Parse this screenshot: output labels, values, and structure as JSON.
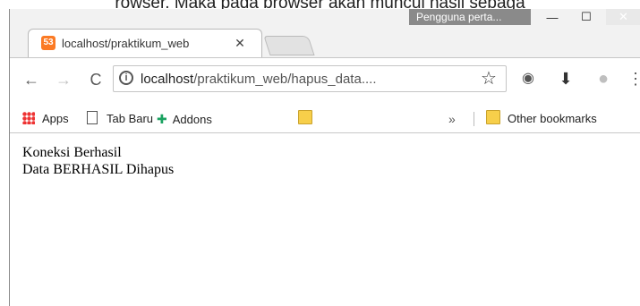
{
  "caption_cut": "rowser. Maka pada browser akan muncul hasil sebaga",
  "window": {
    "profile_label": "Pengguna perta...",
    "min_glyph": "—",
    "max_glyph": "☐",
    "close_glyph": "✕"
  },
  "tab": {
    "favicon_text": "53",
    "title": "localhost/praktikum_web",
    "close_glyph": "✕"
  },
  "toolbar": {
    "back_glyph": "←",
    "forward_glyph": "→",
    "reload_glyph": "C",
    "info_glyph": "i",
    "url_host": "localhost",
    "url_path": "/praktikum_web/hapus_data....",
    "star_glyph": "☆",
    "film_glyph": "◉",
    "download_glyph": "⬇",
    "globe_glyph": "●",
    "menu_glyph": "⋮"
  },
  "bookmarks": {
    "apps": "Apps",
    "tab_baru": "Tab Baru",
    "addons": "Addons",
    "chevron": "»",
    "other": "Other bookmarks",
    "puzzle_glyph": "✚"
  },
  "page": {
    "line1": "Koneksi Berhasil",
    "line2": "Data BERHASIL Dihapus"
  },
  "icons": {
    "favicon": "xampp-icon",
    "info": "info-icon",
    "star": "star-icon",
    "download": "download-icon",
    "globe": "globe-icon",
    "menu": "menu-icon"
  },
  "colors": {
    "favicon_bg": "#fb7a24",
    "profile_badge": "#8a8a8a",
    "addons_icon": "#1aa260",
    "folder": "#f7cf4a"
  }
}
